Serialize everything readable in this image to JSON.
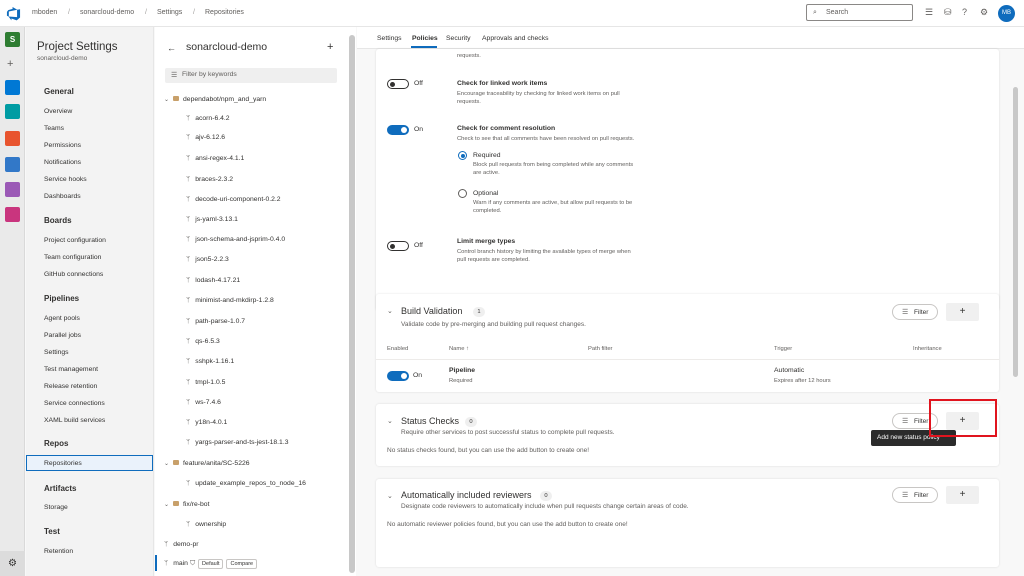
{
  "breadcrumb": [
    "mboden",
    "sonarcloud-demo",
    "Settings",
    "Repositories"
  ],
  "search": {
    "placeholder": "Search"
  },
  "user": {
    "initials": "MB"
  },
  "rail": {
    "project_initial": "S"
  },
  "settings_nav": {
    "title": "Project Settings",
    "subtitle": "sonarcloud-demo",
    "sections": [
      {
        "heading": "General",
        "items": [
          "Overview",
          "Teams",
          "Permissions",
          "Notifications",
          "Service hooks",
          "Dashboards"
        ]
      },
      {
        "heading": "Boards",
        "items": [
          "Project configuration",
          "Team configuration",
          "GitHub connections"
        ]
      },
      {
        "heading": "Pipelines",
        "items": [
          "Agent pools",
          "Parallel jobs",
          "Settings",
          "Test management",
          "Release retention",
          "Service connections",
          "XAML build services"
        ]
      },
      {
        "heading": "Repos",
        "items": [
          "Repositories"
        ]
      },
      {
        "heading": "Artifacts",
        "items": [
          "Storage"
        ]
      },
      {
        "heading": "Test",
        "items": [
          "Retention"
        ]
      }
    ]
  },
  "repo_pane": {
    "title": "sonarcloud-demo",
    "filter_placeholder": "Filter by keywords",
    "folders": [
      {
        "name": "dependabot/npm_and_yarn",
        "branches": [
          "acorn-6.4.2",
          "ajv-6.12.6",
          "ansi-regex-4.1.1",
          "braces-2.3.2",
          "decode-uri-component-0.2.2",
          "js-yaml-3.13.1",
          "json-schema-and-jsprim-0.4.0",
          "json5-2.2.3",
          "lodash-4.17.21",
          "minimist-and-mkdirp-1.2.8",
          "path-parse-1.0.7",
          "qs-6.5.3",
          "sshpk-1.16.1",
          "tmpl-1.0.5",
          "ws-7.4.6",
          "y18n-4.0.1",
          "yargs-parser-and-ts-jest-18.1.3"
        ]
      },
      {
        "name": "feature/anita/SC-5226",
        "branches": [
          "update_example_repos_to_node_16"
        ]
      },
      {
        "name": "fix/re-bot",
        "branches": [
          "ownership"
        ]
      }
    ],
    "root_branches": [
      "demo-pr",
      "main"
    ],
    "main_badges": [
      "Default",
      "Compare"
    ]
  },
  "tabs": [
    "Settings",
    "Policies",
    "Security",
    "Approvals and checks"
  ],
  "policies": {
    "top_cut_text": "requests.",
    "linked_work_items": {
      "state": "Off",
      "title": "Check for linked work items",
      "desc1": "Encourage traceability by checking for linked work items on pull",
      "desc2": "requests."
    },
    "comment_resolution": {
      "state": "On",
      "title": "Check for comment resolution",
      "desc": "Check to see that all comments have been resolved on pull requests.",
      "required": {
        "label": "Required",
        "desc1": "Block pull requests from being completed while any comments",
        "desc2": "are active."
      },
      "optional": {
        "label": "Optional",
        "desc1": "Warn if any comments are active, but allow pull requests to be",
        "desc2": "completed."
      }
    },
    "merge_types": {
      "state": "Off",
      "title": "Limit merge types",
      "desc1": "Control branch history by limiting the available types of merge when",
      "desc2": "pull requests are completed."
    }
  },
  "build_validation": {
    "title": "Build Validation",
    "count": "1",
    "desc": "Validate code by pre-merging and building pull request changes.",
    "filter_label": "Filter",
    "add_label": "+",
    "columns": [
      "Enabled",
      "Name ↑",
      "Path filter",
      "Trigger",
      "Inheritance"
    ],
    "row": {
      "state": "On",
      "name": "Pipeline",
      "status": "Required",
      "trigger": "Automatic",
      "trigger_sub": "Expires after 12 hours"
    }
  },
  "status_checks": {
    "title": "Status Checks",
    "count": "0",
    "desc": "Require other services to post successful status to complete pull requests.",
    "empty": "No status checks found, but you can use the add button to create one!",
    "filter_label": "Filter",
    "add_label": "+",
    "tooltip": "Add new status policy"
  },
  "auto_reviewers": {
    "title": "Automatically included reviewers",
    "count": "0",
    "desc": "Designate code reviewers to automatically include when pull requests change certain areas of code.",
    "empty": "No automatic reviewer policies found, but you can use the add button to create one!",
    "filter_label": "Filter",
    "add_label": "+"
  },
  "colors": {
    "accent": "#0f6cbd",
    "highlight": "#e0141e"
  }
}
